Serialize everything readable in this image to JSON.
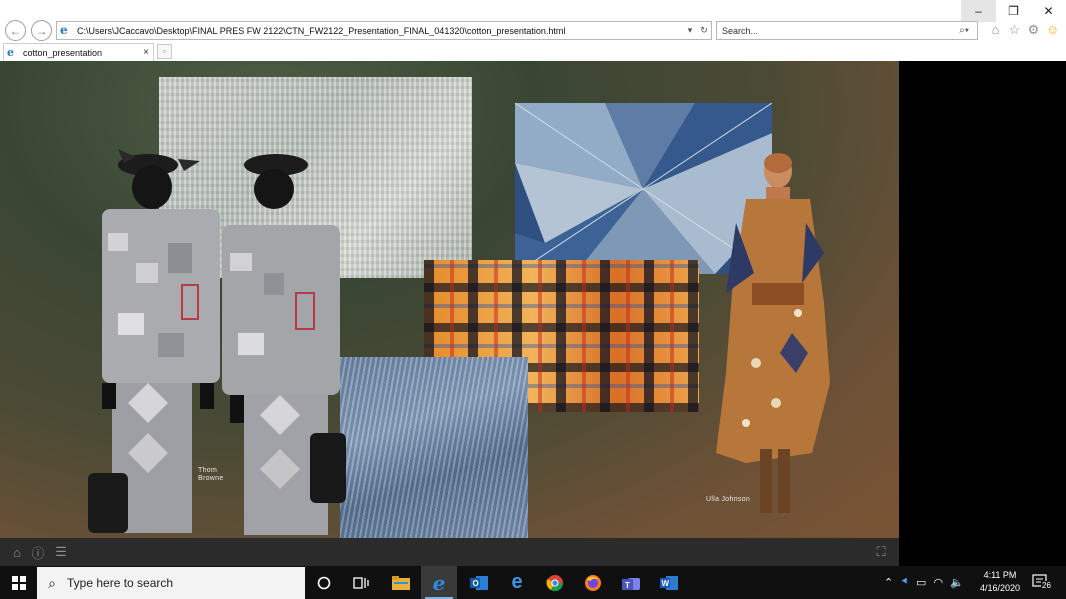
{
  "window": {
    "minimize_glyph": "–",
    "restore_glyph": "❐",
    "close_glyph": "✕"
  },
  "browser": {
    "back_icon": "back-arrow-icon",
    "forward_icon": "forward-arrow-icon",
    "address": "C:\\Users\\JCaccavo\\Desktop\\FINAL PRES FW 2122\\CTN_FW2122_Presentation_FINAL_041320\\cotton_presentation.html",
    "search_placeholder": "Search...",
    "tab_title": "cotton_presentation",
    "tab_close": "×"
  },
  "presentation": {
    "captions": [
      {
        "text": "Thom\nBrowne",
        "line1": "Thom",
        "line2": "Browne"
      },
      {
        "text": "Ulla Johnson"
      }
    ]
  },
  "taskbar": {
    "search_placeholder": "Type here to search",
    "time": "4:11 PM",
    "date": "4/16/2020",
    "notification_count": "26",
    "apps": [
      "task-view",
      "file-explorer",
      "internet-explorer",
      "outlook",
      "edge",
      "chrome",
      "firefox",
      "teams",
      "word"
    ]
  },
  "colors": {
    "accent_blue": "#1e78d7",
    "taskbar": "#101010",
    "pres_toolbar": "#2b2b2b"
  }
}
